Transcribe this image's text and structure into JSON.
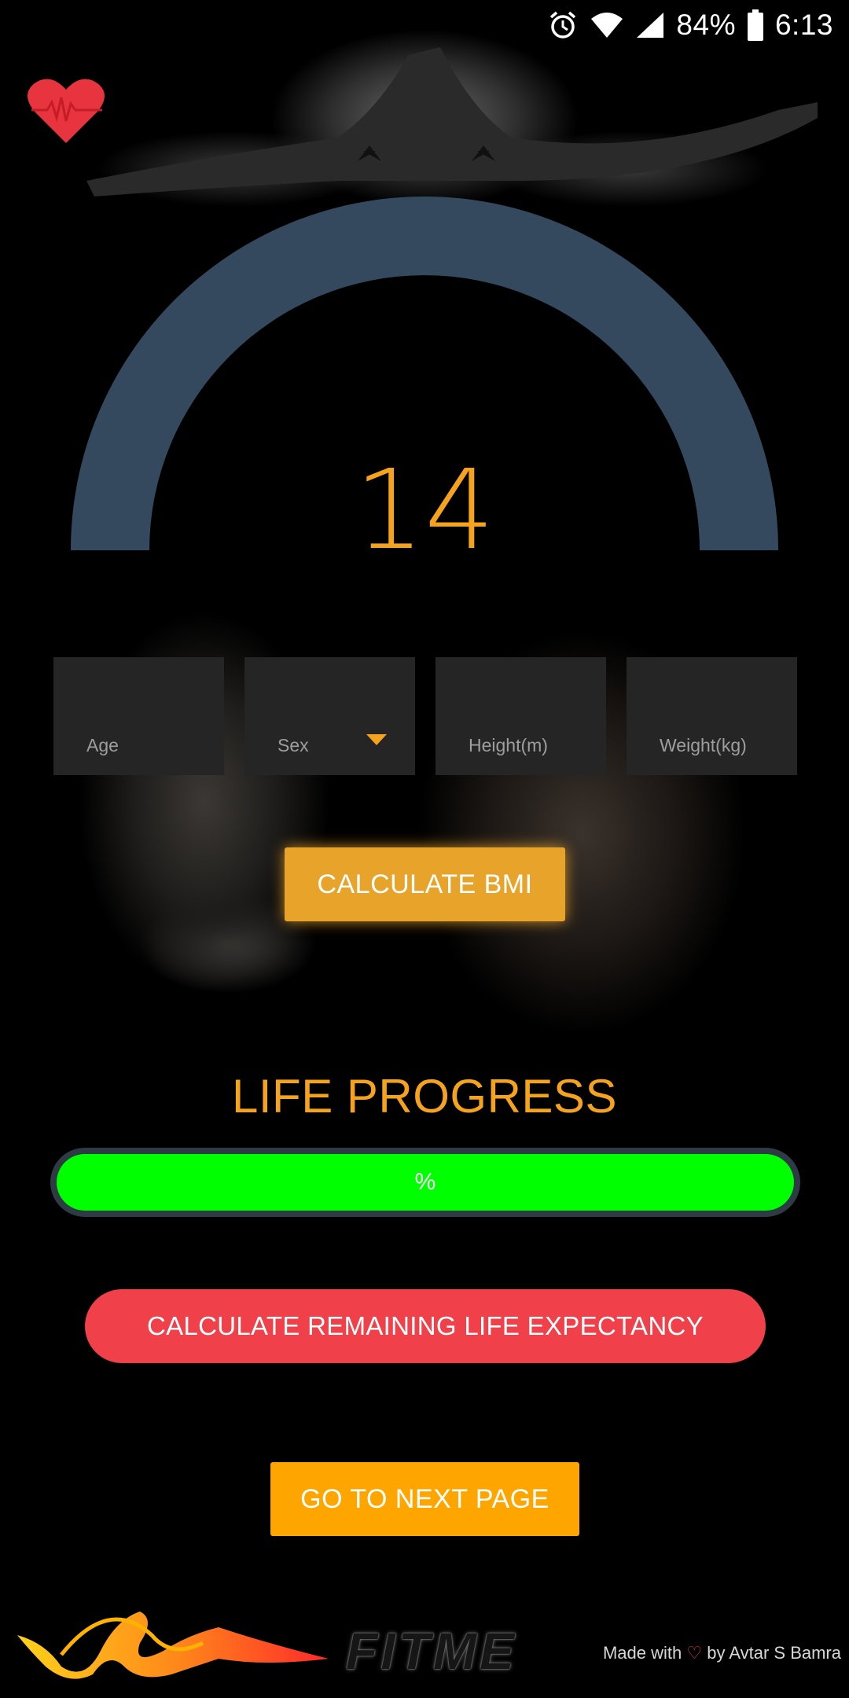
{
  "status_bar": {
    "battery_percent": "84%",
    "time": "6:13",
    "icons": [
      "alarm-icon",
      "wifi-icon",
      "signal-icon",
      "battery-icon"
    ]
  },
  "gauge": {
    "value": "14",
    "colors": {
      "arc": "#34495e",
      "value_text": "#f5a21c"
    }
  },
  "inputs": {
    "age_placeholder": "Age",
    "sex_placeholder": "Sex",
    "height_placeholder": "Height(m)",
    "weight_placeholder": "Weight(kg)"
  },
  "buttons": {
    "calculate_bmi": "CALCULATE BMI",
    "calculate_life": "CALCULATE REMAINING LIFE EXPECTANCY",
    "next_page": "GO TO NEXT PAGE"
  },
  "life_progress": {
    "title": "LIFE PROGRESS",
    "label": "%",
    "fill_fraction": 1.0,
    "colors": {
      "fill": "#00ff00",
      "track": "#2e3a44"
    }
  },
  "footer": {
    "logo_text": "FITME",
    "credit_prefix": "Made with",
    "credit_heart": "♡",
    "credit_suffix": "by Avtar S Bamra"
  },
  "colors": {
    "accent_orange": "#f5a21c",
    "bmi_button": "#e8a42a",
    "life_button": "#f0404a",
    "next_button": "#ffa500",
    "input_bg": "#252525"
  }
}
